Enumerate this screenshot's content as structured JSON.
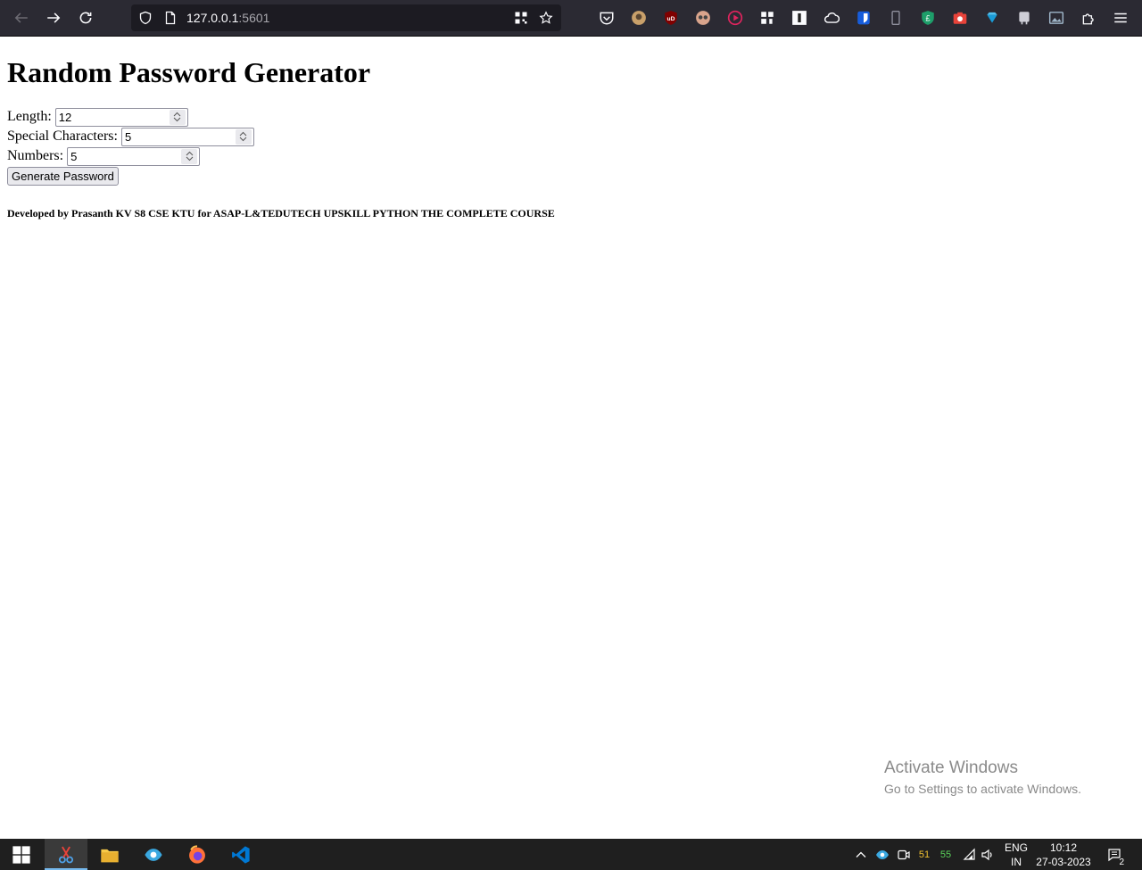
{
  "browser": {
    "url_host": "127.0.0.1",
    "url_port": ":5601"
  },
  "page": {
    "title": "Random Password Generator",
    "fields": [
      {
        "label": "Length:",
        "value": "12"
      },
      {
        "label": "Special Characters:",
        "value": "5"
      },
      {
        "label": "Numbers:",
        "value": "5"
      }
    ],
    "generate_label": "Generate Password",
    "credit": "Developed by Prasanth KV S8 CSE KTU for ASAP-L&TEDUTECH UPSKILL PYTHON THE COMPLETE COURSE"
  },
  "watermark": {
    "title": "Activate Windows",
    "subtitle": "Go to Settings to activate Windows."
  },
  "taskbar": {
    "cpu_temp": "51",
    "gpu_temp": "55",
    "language": "ENG",
    "region": "IN",
    "time": "10:12",
    "date": "27-03-2023",
    "notification_count": "2"
  }
}
